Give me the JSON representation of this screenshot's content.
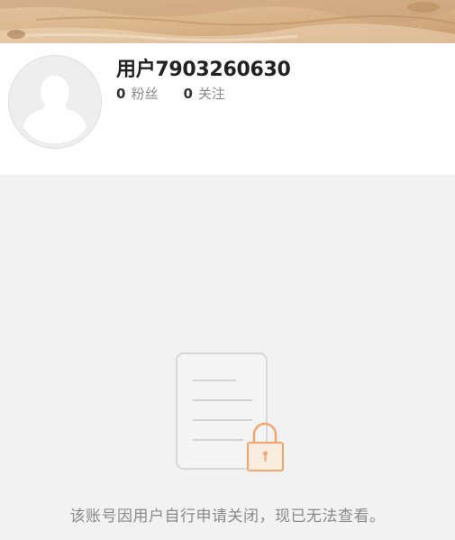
{
  "cover": {
    "image": "sand-beach-cover-image"
  },
  "profile": {
    "avatar_icon": "default-user-avatar-icon",
    "username": "用户7903260630",
    "followers": {
      "count": "0",
      "label": "粉丝"
    },
    "following": {
      "count": "0",
      "label": "关注"
    }
  },
  "empty_state": {
    "icon": "locked-document-icon",
    "message": "该账号因用户自行申请关闭，现已无法查看。"
  },
  "colors": {
    "page_background": "#f2f2f2",
    "card_background": "#ffffff",
    "lock_accent": "#f5a46a",
    "muted_text": "#8a8a8a"
  }
}
